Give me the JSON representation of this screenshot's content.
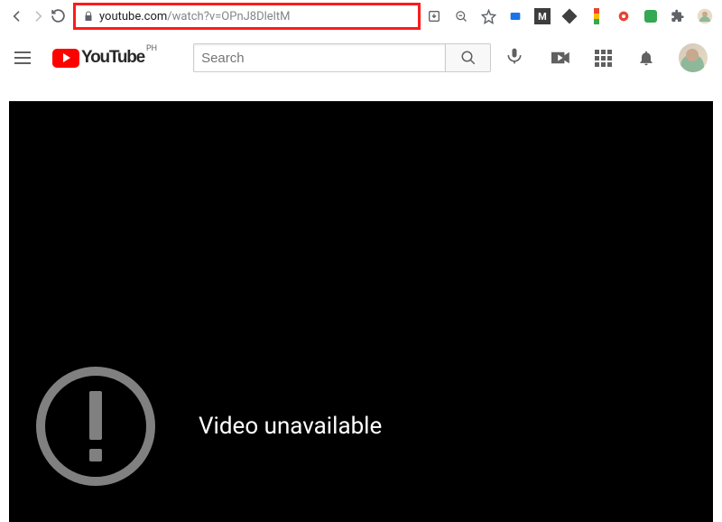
{
  "browser": {
    "url_domain": "youtube.com",
    "url_path": "/watch?v=OPnJ8DleltM"
  },
  "youtube": {
    "logo_text": "YouTube",
    "country": "PH",
    "search_placeholder": "Search"
  },
  "player": {
    "error_message": "Video unavailable"
  }
}
